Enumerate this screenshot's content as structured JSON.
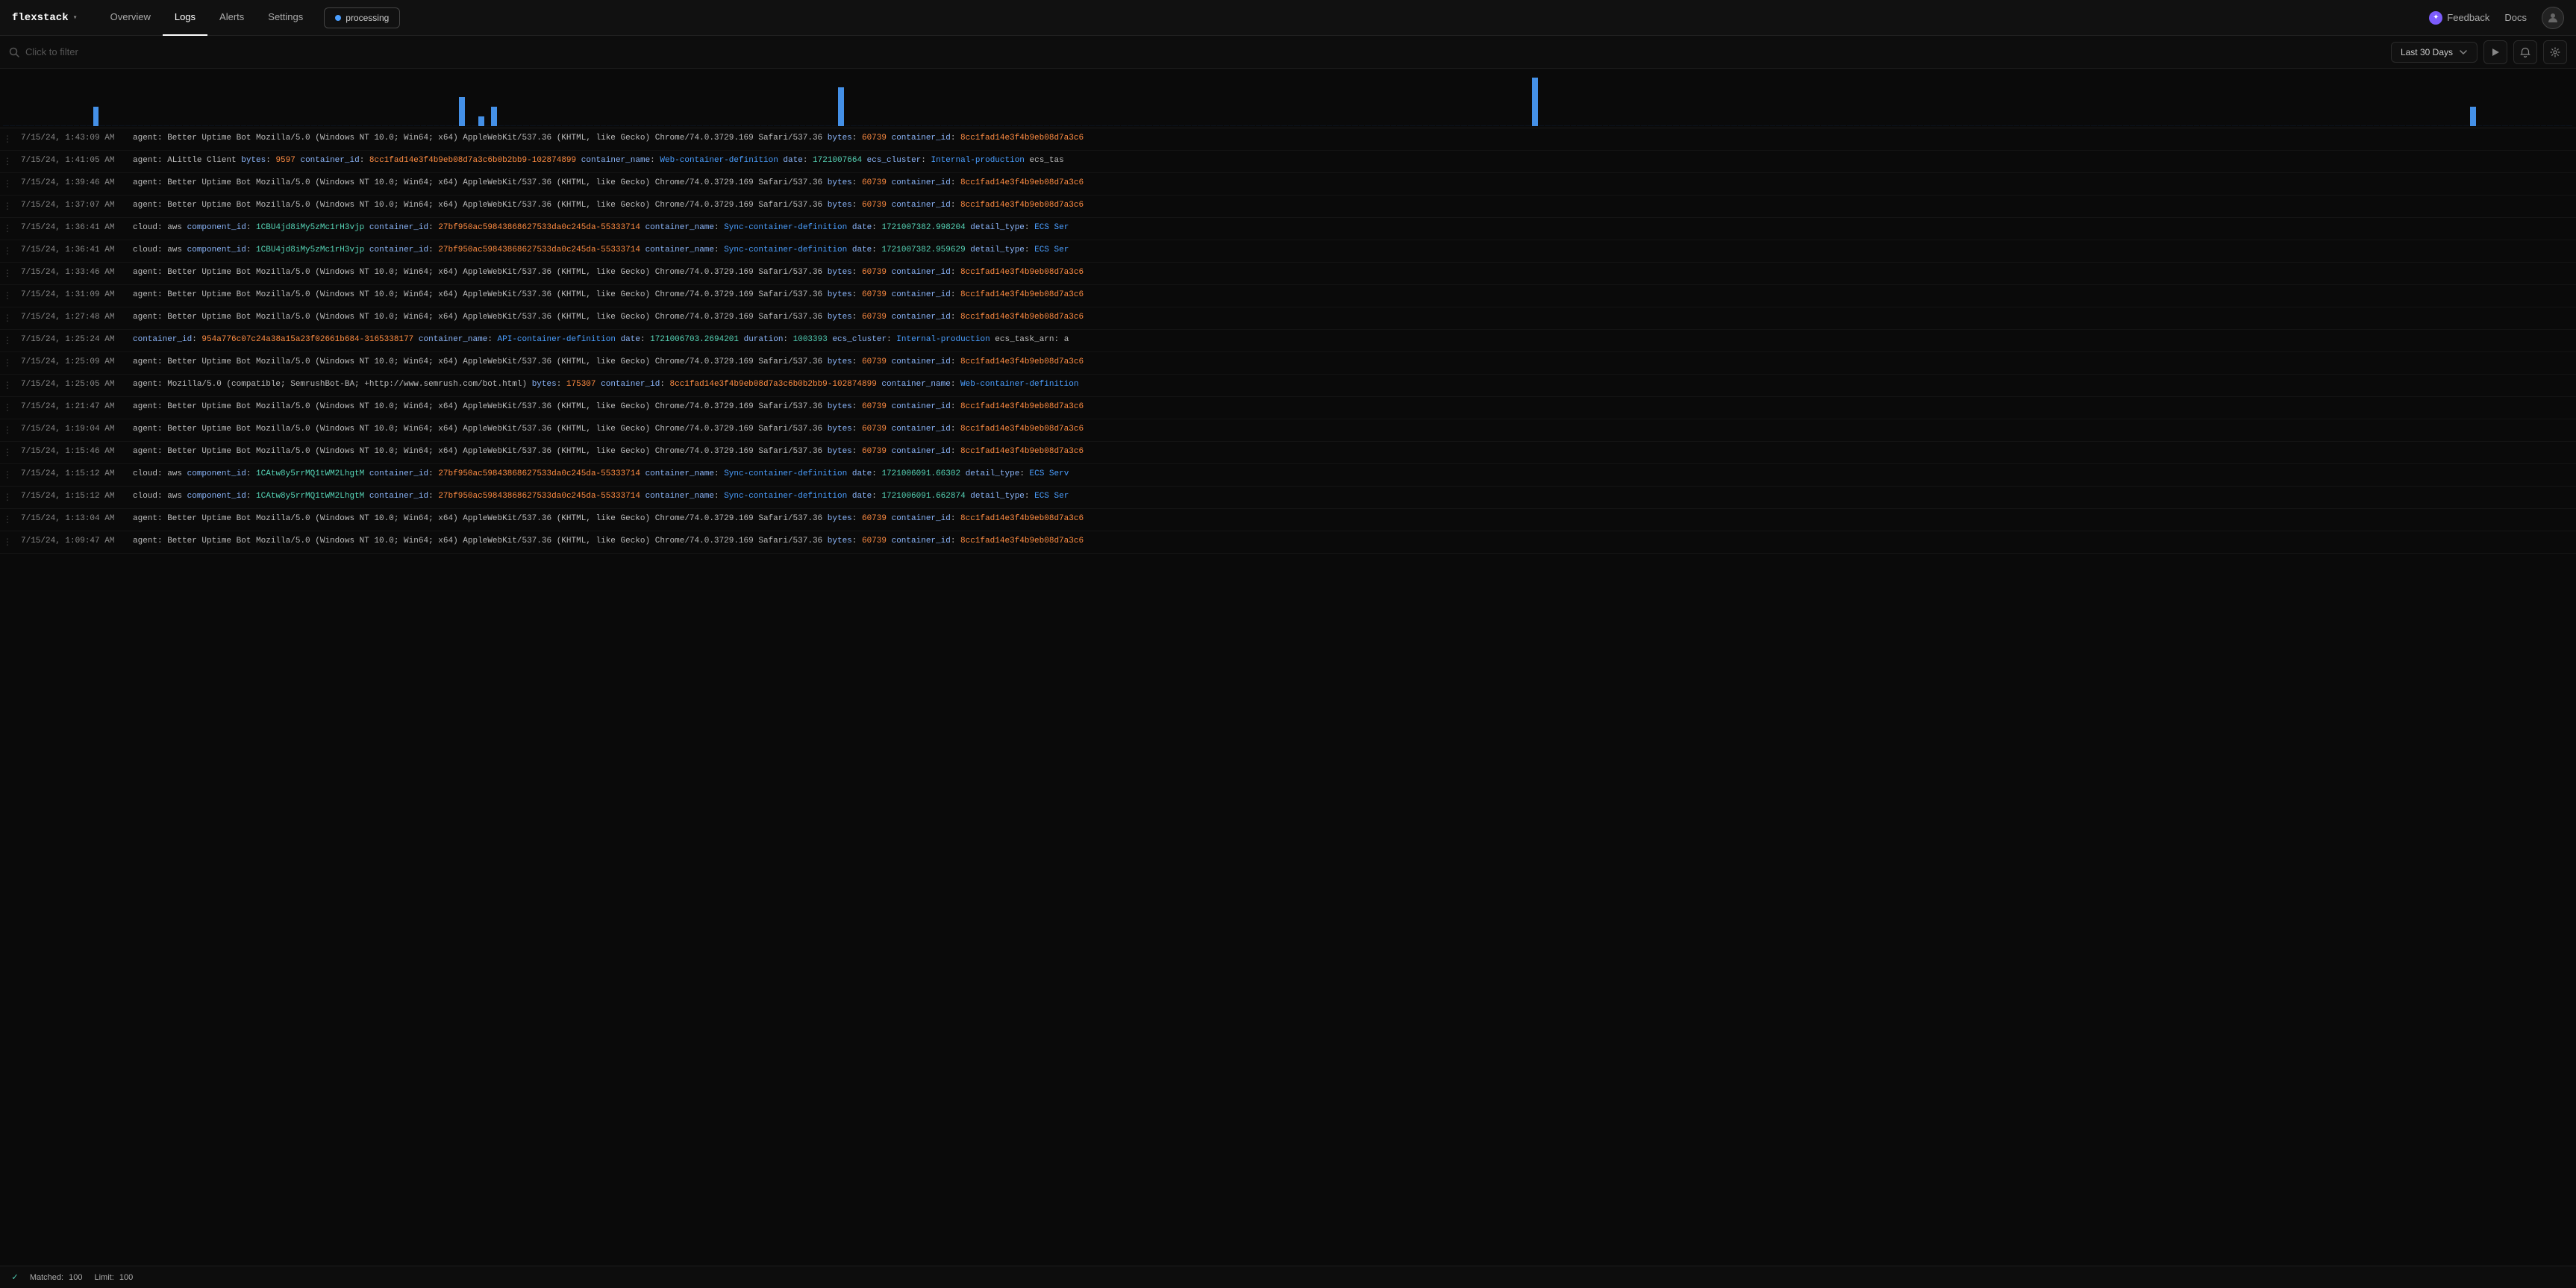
{
  "brand": {
    "name": "flexstack",
    "chevron": "▾"
  },
  "nav": {
    "items": [
      {
        "label": "Overview",
        "active": false
      },
      {
        "label": "Logs",
        "active": true
      },
      {
        "label": "Alerts",
        "active": false
      },
      {
        "label": "Settings",
        "active": false
      }
    ],
    "processing_label": "processing",
    "feedback_label": "Feedback",
    "docs_label": "Docs"
  },
  "filterbar": {
    "search_placeholder": "Click to filter",
    "date_range": "Last 30 Days"
  },
  "footer": {
    "matched_label": "Matched:",
    "matched_value": "100",
    "limit_label": "Limit:",
    "limit_value": "100"
  },
  "logs": [
    {
      "timestamp": "7/15/24, 1:43:09 AM",
      "message": "agent: Better Uptime Bot Mozilla/5.0 (Windows NT 10.0; Win64; x64) AppleWebKit/537.36 (KHTML, like Gecko) Chrome/74.0.3729.169 Safari/537.36  bytes: 60739  container_id: 8cc1fad14e3f4b9eb08d7a3c6"
    },
    {
      "timestamp": "7/15/24, 1:41:05 AM",
      "message": "agent: ALittle Client  bytes: 9597  container_id: 8cc1fad14e3f4b9eb08d7a3c6b0b2bb9-102874899  container_name: Web-container-definition  date: 1721007664  ecs_cluster: Internal-production  ecs_tas"
    },
    {
      "timestamp": "7/15/24, 1:39:46 AM",
      "message": "agent: Better Uptime Bot Mozilla/5.0 (Windows NT 10.0; Win64; x64) AppleWebKit/537.36 (KHTML, like Gecko) Chrome/74.0.3729.169 Safari/537.36  bytes: 60739  container_id: 8cc1fad14e3f4b9eb08d7a3c6"
    },
    {
      "timestamp": "7/15/24, 1:37:07 AM",
      "message": "agent: Better Uptime Bot Mozilla/5.0 (Windows NT 10.0; Win64; x64) AppleWebKit/537.36 (KHTML, like Gecko) Chrome/74.0.3729.169 Safari/537.36  bytes: 60739  container_id: 8cc1fad14e3f4b9eb08d7a3c6"
    },
    {
      "timestamp": "7/15/24, 1:36:41 AM",
      "message": "cloud: aws  component_id: 1CBU4jd8iMy5zMc1rH3vjp  container_id: 27bf950ac59843868627533da0c245da-55333714  container_name: Sync-container-definition  date: 1721007382.998204  detail_type: ECS Ser"
    },
    {
      "timestamp": "7/15/24, 1:36:41 AM",
      "message": "cloud: aws  component_id: 1CBU4jd8iMy5zMc1rH3vjp  container_id: 27bf950ac59843868627533da0c245da-55333714  container_name: Sync-container-definition  date: 1721007382.959629  detail_type: ECS Ser"
    },
    {
      "timestamp": "7/15/24, 1:33:46 AM",
      "message": "agent: Better Uptime Bot Mozilla/5.0 (Windows NT 10.0; Win64; x64) AppleWebKit/537.36 (KHTML, like Gecko) Chrome/74.0.3729.169 Safari/537.36  bytes: 60739  container_id: 8cc1fad14e3f4b9eb08d7a3c6"
    },
    {
      "timestamp": "7/15/24, 1:31:09 AM",
      "message": "agent: Better Uptime Bot Mozilla/5.0 (Windows NT 10.0; Win64; x64) AppleWebKit/537.36 (KHTML, like Gecko) Chrome/74.0.3729.169 Safari/537.36  bytes: 60739  container_id: 8cc1fad14e3f4b9eb08d7a3c6"
    },
    {
      "timestamp": "7/15/24, 1:27:48 AM",
      "message": "agent: Better Uptime Bot Mozilla/5.0 (Windows NT 10.0; Win64; x64) AppleWebKit/537.36 (KHTML, like Gecko) Chrome/74.0.3729.169 Safari/537.36  bytes: 60739  container_id: 8cc1fad14e3f4b9eb08d7a3c6"
    },
    {
      "timestamp": "7/15/24, 1:25:24 AM",
      "message": "container_id: 954a776c07c24a38a15a23f02661b684-3165338177  container_name: API-container-definition  date: 1721006703.2694201  duration: 1003393  ecs_cluster: Internal-production  ecs_task_arn: a"
    },
    {
      "timestamp": "7/15/24, 1:25:09 AM",
      "message": "agent: Better Uptime Bot Mozilla/5.0 (Windows NT 10.0; Win64; x64) AppleWebKit/537.36 (KHTML, like Gecko) Chrome/74.0.3729.169 Safari/537.36  bytes: 60739  container_id: 8cc1fad14e3f4b9eb08d7a3c6"
    },
    {
      "timestamp": "7/15/24, 1:25:05 AM",
      "message": "agent: Mozilla/5.0 (compatible; SemrushBot-BA; +http://www.semrush.com/bot.html)  bytes: 175307  container_id: 8cc1fad14e3f4b9eb08d7a3c6b0b2bb9-102874899  container_name: Web-container-definition"
    },
    {
      "timestamp": "7/15/24, 1:21:47 AM",
      "message": "agent: Better Uptime Bot Mozilla/5.0 (Windows NT 10.0; Win64; x64) AppleWebKit/537.36 (KHTML, like Gecko) Chrome/74.0.3729.169 Safari/537.36  bytes: 60739  container_id: 8cc1fad14e3f4b9eb08d7a3c6"
    },
    {
      "timestamp": "7/15/24, 1:19:04 AM",
      "message": "agent: Better Uptime Bot Mozilla/5.0 (Windows NT 10.0; Win64; x64) AppleWebKit/537.36 (KHTML, like Gecko) Chrome/74.0.3729.169 Safari/537.36  bytes: 60739  container_id: 8cc1fad14e3f4b9eb08d7a3c6"
    },
    {
      "timestamp": "7/15/24, 1:15:46 AM",
      "message": "agent: Better Uptime Bot Mozilla/5.0 (Windows NT 10.0; Win64; x64) AppleWebKit/537.36 (KHTML, like Gecko) Chrome/74.0.3729.169 Safari/537.36  bytes: 60739  container_id: 8cc1fad14e3f4b9eb08d7a3c6"
    },
    {
      "timestamp": "7/15/24, 1:15:12 AM",
      "message": "cloud: aws  component_id: 1CAtw8y5rrMQ1tWM2LhgtM  container_id: 27bf950ac59843868627533da0c245da-55333714  container_name: Sync-container-definition  date: 1721006091.66302  detail_type: ECS Serv"
    },
    {
      "timestamp": "7/15/24, 1:15:12 AM",
      "message": "cloud: aws  component_id: 1CAtw8y5rrMQ1tWM2LhgtM  container_id: 27bf950ac59843868627533da0c245da-55333714  container_name: Sync-container-definition  date: 1721006091.662874  detail_type: ECS Ser"
    },
    {
      "timestamp": "7/15/24, 1:13:04 AM",
      "message": "agent: Better Uptime Bot Mozilla/5.0 (Windows NT 10.0; Win64; x64) AppleWebKit/537.36 (KHTML, like Gecko) Chrome/74.0.3729.169 Safari/537.36  bytes: 60739  container_id: 8cc1fad14e3f4b9eb08d7a3c6"
    },
    {
      "timestamp": "7/15/24, 1:09:47 AM",
      "message": "agent: Better Uptime Bot Mozilla/5.0 (Windows NT 10.0; Win64; x64) AppleWebKit/537.36 (KHTML, like Gecko) Chrome/74.0.3729.169 Safari/537.36  bytes: 60739  container_id: 8cc1fad14e3f4b9eb08d7a3c6"
    }
  ],
  "histogram_bars": [
    0,
    0,
    0,
    0,
    0,
    0,
    0,
    0,
    0,
    0,
    0,
    0,
    0,
    0,
    2,
    0,
    0,
    0,
    0,
    0,
    0,
    0,
    0,
    0,
    0,
    0,
    0,
    0,
    0,
    0,
    0,
    0,
    0,
    0,
    0,
    0,
    0,
    0,
    0,
    0,
    0,
    0,
    0,
    0,
    0,
    0,
    0,
    0,
    0,
    0,
    0,
    0,
    0,
    0,
    0,
    0,
    0,
    0,
    0,
    0,
    0,
    0,
    0,
    0,
    0,
    0,
    0,
    0,
    0,
    0,
    0,
    3,
    0,
    0,
    1,
    0,
    2,
    0,
    0,
    0,
    0,
    0,
    0,
    0,
    0,
    0,
    0,
    0,
    0,
    0,
    0,
    0,
    0,
    0,
    0,
    0,
    0,
    0,
    0,
    0,
    0,
    0,
    0,
    0,
    0,
    0,
    0,
    0,
    0,
    0,
    0,
    0,
    0,
    0,
    0,
    0,
    0,
    0,
    0,
    0,
    0,
    0,
    0,
    0,
    0,
    0,
    0,
    0,
    0,
    0,
    4,
    0,
    0,
    0,
    0,
    0,
    0,
    0,
    0,
    0,
    0,
    0,
    0,
    0,
    0,
    0,
    0,
    0,
    0,
    0,
    0,
    0,
    0,
    0,
    0,
    0,
    0,
    0,
    0,
    0,
    0,
    0,
    0,
    0,
    0,
    0,
    0,
    0,
    0,
    0,
    0,
    0,
    0,
    0,
    0,
    0,
    0,
    0,
    0,
    0,
    0,
    0,
    0,
    0,
    0,
    0,
    0,
    0,
    0,
    0,
    0,
    0,
    0,
    0,
    0,
    0,
    0,
    0,
    0,
    0,
    0,
    0,
    0,
    0,
    0,
    0,
    0,
    0,
    0,
    0,
    0,
    0,
    0,
    0,
    0,
    0,
    0,
    0,
    0,
    0,
    0,
    0,
    0,
    0,
    0,
    0,
    0,
    0,
    0,
    0,
    0,
    0,
    0,
    0,
    0,
    0,
    0,
    0,
    5,
    0,
    0,
    0,
    0,
    0,
    0,
    0,
    0,
    0,
    0,
    0,
    0,
    0,
    0,
    0,
    0,
    0,
    0,
    0,
    0,
    0,
    0,
    0,
    0,
    0,
    0,
    0,
    0,
    0,
    0,
    0,
    0,
    0,
    0,
    0,
    0,
    0,
    0,
    0,
    0,
    0,
    0,
    0,
    0,
    0,
    0,
    0,
    0,
    0,
    0,
    0,
    0,
    0,
    0,
    0,
    0,
    0,
    0,
    0,
    0,
    0,
    0,
    0,
    0,
    0,
    0,
    0,
    0,
    0,
    0,
    0,
    0,
    0,
    0,
    0,
    0,
    0,
    0,
    0,
    0,
    0,
    0,
    0,
    0,
    0,
    0,
    0,
    0,
    0,
    0,
    0,
    0,
    0,
    0,
    0,
    0,
    0,
    0,
    0,
    0,
    0,
    0,
    0,
    0,
    0,
    0,
    0,
    0,
    0,
    0,
    0,
    0,
    0,
    0,
    0,
    0,
    0,
    0,
    0,
    0,
    0,
    0,
    0,
    0,
    0,
    0,
    0,
    0,
    0,
    0,
    0,
    0,
    0,
    0,
    0,
    0,
    0,
    0,
    0,
    0,
    0,
    0,
    0,
    0,
    0,
    2,
    0,
    0,
    0,
    0,
    0,
    0,
    0,
    0,
    0,
    0,
    0,
    0,
    0,
    0,
    0
  ]
}
